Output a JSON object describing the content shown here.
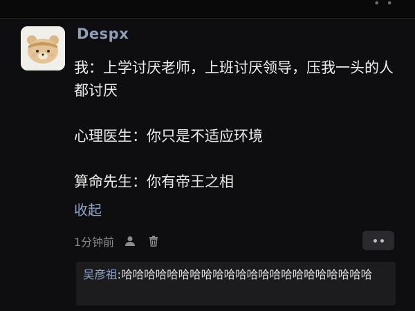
{
  "comment": {
    "username": "Despx",
    "lines": [
      "我：上学讨厌老师，上班讨厌领导，压我一头的人都讨厌",
      "心理医生：你只是不适应环境",
      "算命先生：你有帝王之相"
    ],
    "collapse_label": "收起",
    "time": "1分钟前"
  },
  "reply": {
    "author": "吴彦祖",
    "separator": ":",
    "text": "哈哈哈哈哈哈哈哈哈哈哈哈哈哈哈哈哈哈哈哈哈哈"
  },
  "icons": {
    "avatar": "cartoon-bear-avatar",
    "like": "person-icon",
    "delete": "trash-icon",
    "more": "more-dots-icon"
  },
  "colors": {
    "background": "#0e0e10",
    "username": "#8f9db8",
    "link": "#8ea4c8",
    "reply_bg": "#1c1c1f"
  }
}
